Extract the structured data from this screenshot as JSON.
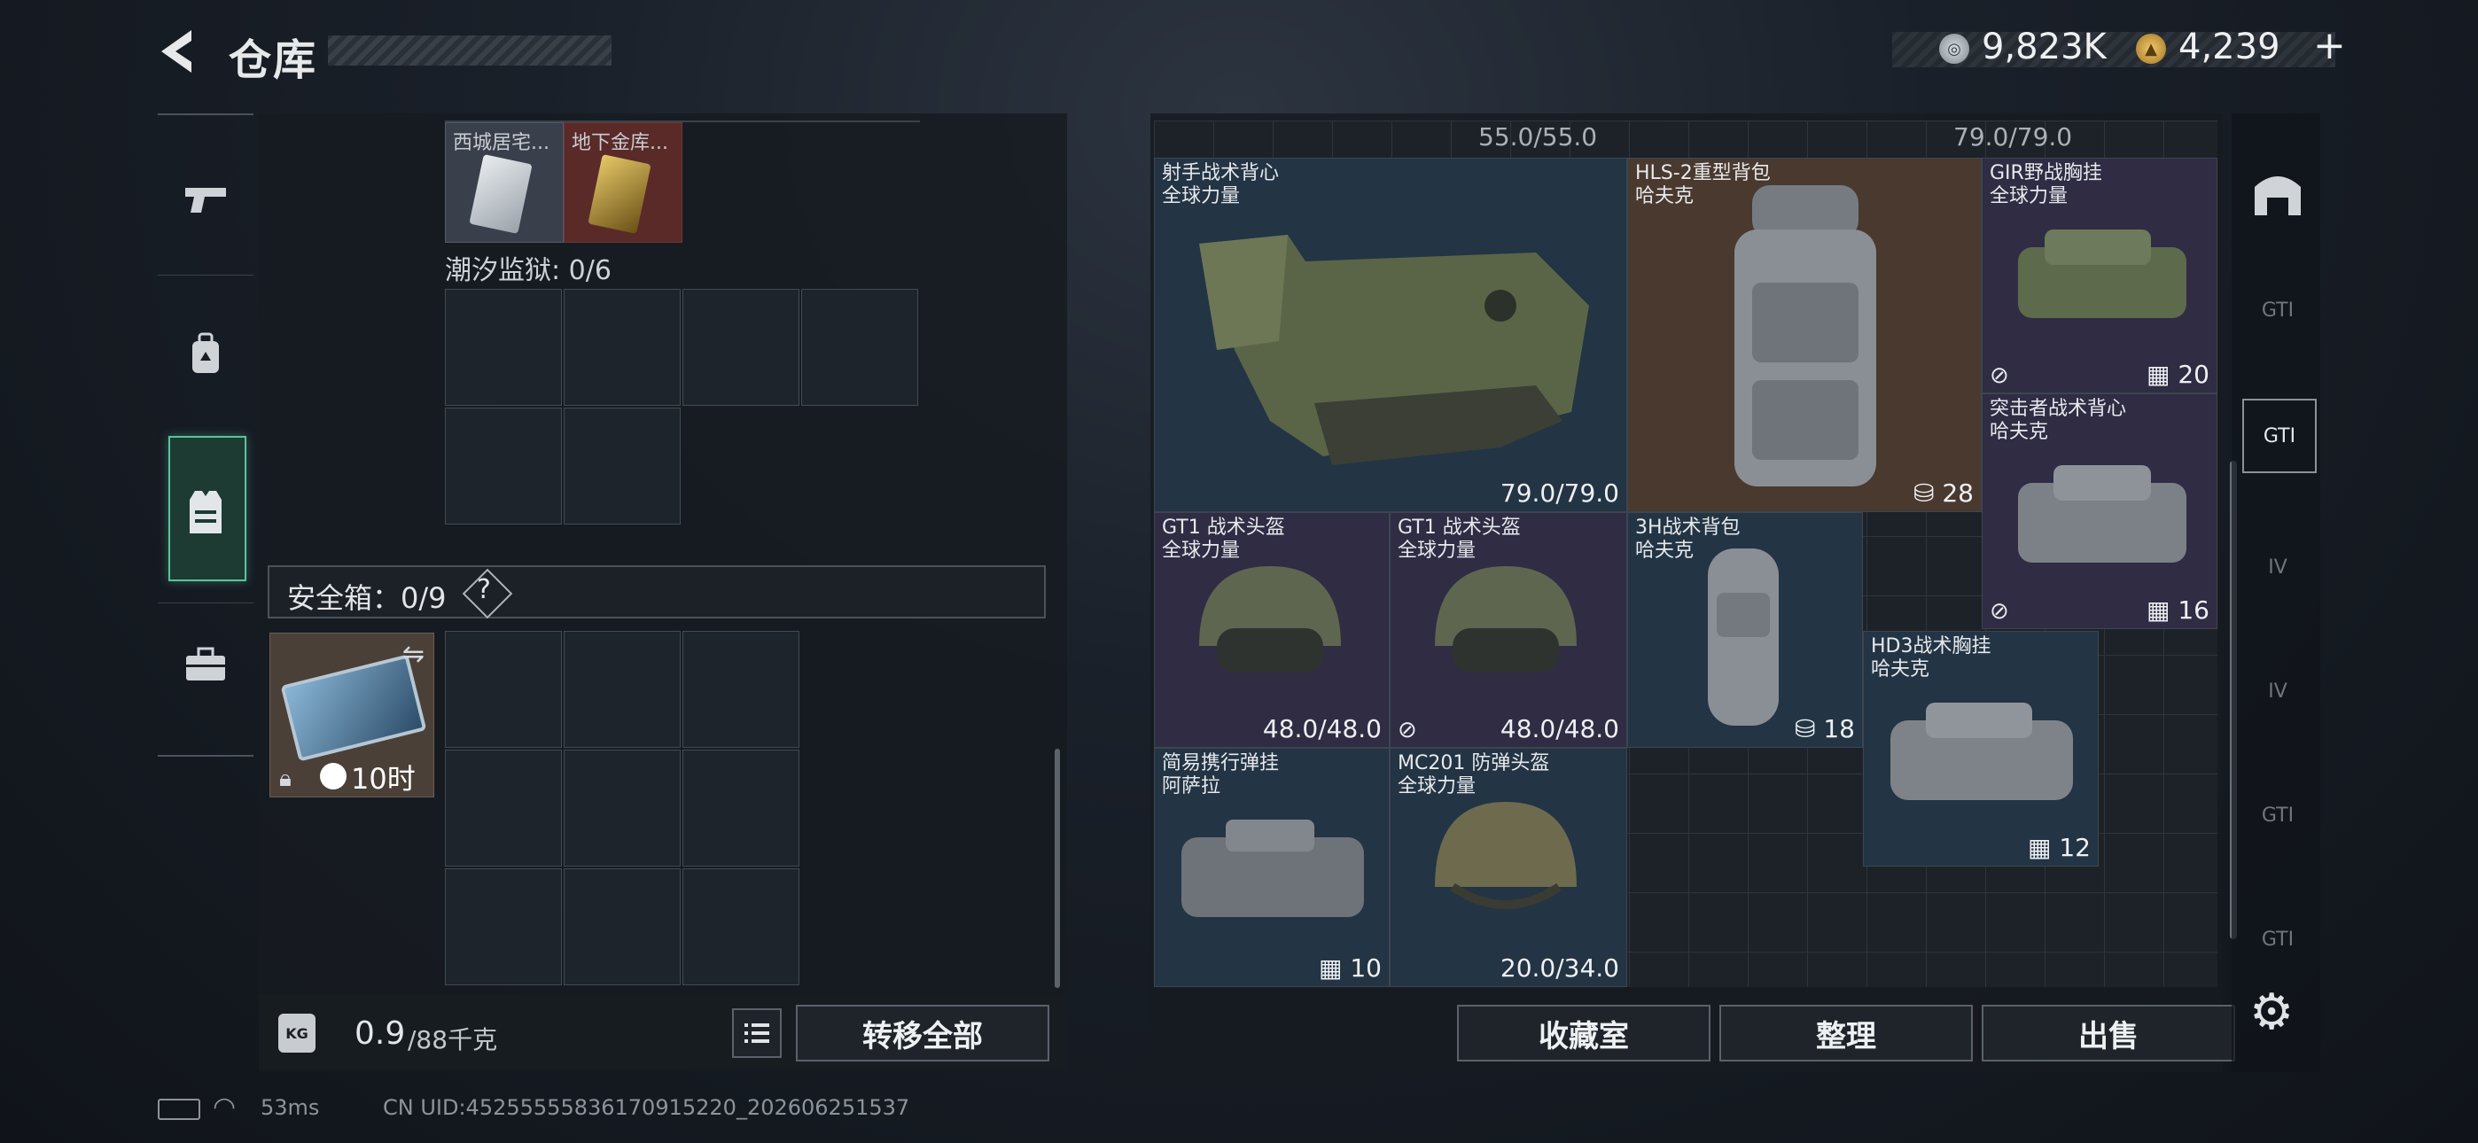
{
  "header": {
    "title": "仓库",
    "currency_silver": "9,823K",
    "currency_gold": "4,239",
    "add_label": "+"
  },
  "left_nav": {
    "items": [
      "pistol-icon",
      "backpack-icon",
      "vest-icon",
      "briefcase-icon"
    ],
    "active": "vest-icon"
  },
  "keys": {
    "items": [
      {
        "name": "西城居宅...",
        "color": "#3a3f4c"
      },
      {
        "name": "地下金库...",
        "color": "#5a2a28"
      }
    ],
    "tide_prison_label": "潮汐监狱: 0/6"
  },
  "safe_box": {
    "label": "安全箱：0/9",
    "help": "?",
    "case_time": "10时"
  },
  "weight": {
    "value": "0.9",
    "max": "/88千克"
  },
  "left_actions": {
    "transfer_all": "转移全部"
  },
  "stash": {
    "top_capacities": [
      "55.0/55.0",
      "79.0/79.0"
    ],
    "items": [
      {
        "name": "射手战术背心",
        "sub": "全球力量",
        "durability": "79.0/79.0",
        "color": "blue"
      },
      {
        "name": "HLS-2重型背包",
        "sub": "哈夫克",
        "count": "28",
        "color": "brown"
      },
      {
        "name": "GIR野战胸挂",
        "sub": "全球力量",
        "count": "20",
        "color": "purple"
      },
      {
        "name": "突击者战术背心",
        "sub": "哈夫克",
        "count": "16",
        "color": "purple"
      },
      {
        "name": "GT1 战术头盔",
        "sub": "全球力量",
        "durability": "48.0/48.0",
        "color": "purple"
      },
      {
        "name": "GT1 战术头盔",
        "sub": "全球力量",
        "durability": "48.0/48.0",
        "color": "purple"
      },
      {
        "name": "3H战术背包",
        "sub": "哈夫克",
        "count": "18",
        "color": "blue"
      },
      {
        "name": "HD3战术胸挂",
        "sub": "哈夫克",
        "count": "12",
        "color": "blue"
      },
      {
        "name": "简易携行弹挂",
        "sub": "阿萨拉",
        "count": "10",
        "color": "blue"
      },
      {
        "name": "MC201 防弹头盔",
        "sub": "全球力量",
        "durability": "20.0/34.0",
        "color": "blue"
      }
    ]
  },
  "right_actions": {
    "collection": "收藏室",
    "organize": "整理",
    "sell": "出售"
  },
  "right_nav": {
    "items": [
      "base-icon",
      "GTI",
      "GTI",
      "IV",
      "IV",
      "GTI",
      "GTI"
    ]
  },
  "footer": {
    "ping": "53ms",
    "uid": "CN UID:4525555583617091522​0_202606251537"
  },
  "colors": {
    "accent_green": "#59c49b",
    "item_blue": "#233444",
    "item_purple": "#2f2c44",
    "item_brown": "#4a392e"
  }
}
